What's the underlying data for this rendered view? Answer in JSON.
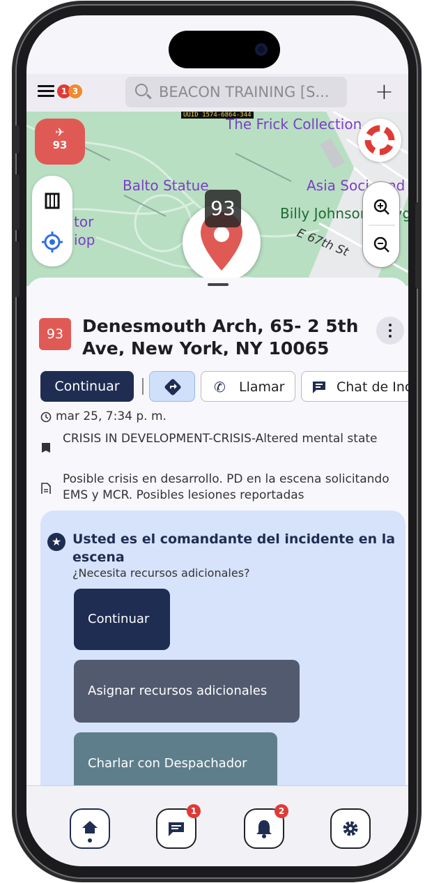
{
  "status_bar": {
    "menu_badges": [
      "1",
      "3"
    ]
  },
  "header": {
    "search_value": "BEACON TRAINING [S...",
    "add_label": "+"
  },
  "map": {
    "uuid_tag": "UUID 1574-6864-344",
    "unit_number": "93",
    "labels": {
      "frick": "The Frick Collection",
      "balto": "Balto Statue",
      "asia": "Asia Soci",
      "billy": "Billy Johnson Playgr",
      "street": "E 67th St",
      "tor": "tor",
      "iop": "iop",
      "nd": "nd"
    },
    "marker_label": "93",
    "icons": [
      "ambulance-icon",
      "lifebuoy-icon",
      "map-icon",
      "locate-icon",
      "zoom-in-icon",
      "zoom-out-icon"
    ]
  },
  "incident": {
    "badge": "93",
    "title": "Denesmouth Arch, 65- 2 5th Ave, New York, NY 10065",
    "actions": {
      "continue": "Continuar",
      "call": "Llamar",
      "chat": "Chat de Incid"
    },
    "time": "mar 25, 7:34 p. m.",
    "type": "CRISIS IN DEVELOPMENT-CRISIS-Altered mental state",
    "description": "Posible crisis en desarrollo. PD en la escena solicitando EMS y MCR. Posibles lesiones reportadas"
  },
  "commander": {
    "title": "Usted es el comandante del incidente en la escena",
    "subtitle": "¿Necesita recursos adicionales?",
    "buttons": {
      "continue": "Continuar",
      "assign": "Asignar recursos adicionales",
      "chat": "Charlar con Despachador"
    },
    "colors": {
      "continue": "#1f2d52",
      "assign": "#525a6f",
      "chat": "#5e7e8c"
    }
  },
  "bottom_nav": {
    "chat_badge": "1",
    "alerts_badge": "2"
  }
}
